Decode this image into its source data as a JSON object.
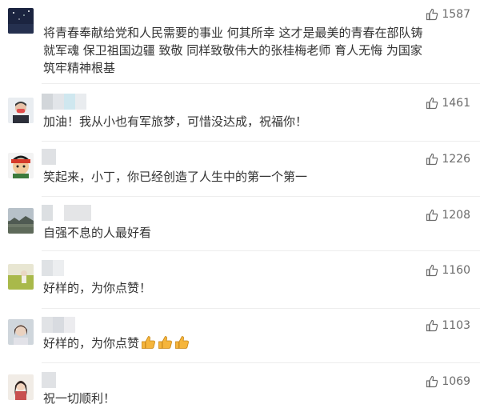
{
  "comments": [
    {
      "text": "将青春奉献给党和人民需要的事业 何其所幸 这才是最美的青春在部队铸就军魂 保卫祖国边疆 致敬 同样致敬伟大的张桂梅老师 育人无悔 为国家筑牢精神根基",
      "likes": "1587",
      "avatar": "night-sky-avatar"
    },
    {
      "text": "加油！我从小也有军旅梦，可惜没达成，祝福你！",
      "likes": "1461",
      "avatar": "masked-person-avatar"
    },
    {
      "text": "笑起来，小丁，你已经创造了人生中的第一个第一",
      "likes": "1226",
      "avatar": "cartoon-character-avatar"
    },
    {
      "text": "自强不息的人最好看",
      "likes": "1208",
      "avatar": "landscape-avatar"
    },
    {
      "text": "好样的，为你点赞！",
      "likes": "1160",
      "avatar": "field-avatar"
    },
    {
      "text": "好样的，为你点赞",
      "likes": "1103",
      "avatar": "person-avatar"
    },
    {
      "text": "祝一切顺利！",
      "likes": "1069",
      "avatar": "girl-avatar"
    }
  ],
  "icons": {
    "like": "thumbs-up-icon",
    "emoji": "thumbs-up-emoji"
  },
  "colors": {
    "like_icon": "#6b6b6b",
    "divider": "#ededed",
    "emoji": "#f5b53c"
  }
}
